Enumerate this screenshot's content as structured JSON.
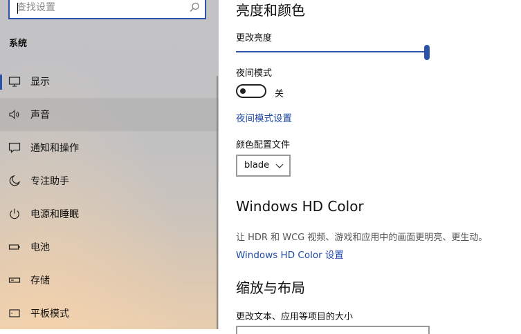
{
  "sidebar": {
    "search": {
      "placeholder": "查找设置",
      "icon": "search-icon"
    },
    "section_title": "系统",
    "items": [
      {
        "label": "显示",
        "icon": "monitor-icon"
      },
      {
        "label": "声音",
        "icon": "speaker-icon"
      },
      {
        "label": "通知和操作",
        "icon": "notification-icon"
      },
      {
        "label": "专注助手",
        "icon": "moon-icon"
      },
      {
        "label": "电源和睡眠",
        "icon": "power-icon"
      },
      {
        "label": "电池",
        "icon": "battery-icon"
      },
      {
        "label": "存储",
        "icon": "storage-icon"
      },
      {
        "label": "平板模式",
        "icon": "tablet-icon"
      }
    ],
    "active_index": 0,
    "hover_index": 1
  },
  "main": {
    "brightness_title": "亮度和颜色",
    "change_brightness_label": "更改亮度",
    "brightness_value": 100,
    "night_light_label": "夜间模式",
    "night_light_state": "关",
    "night_light_settings_link": "夜间模式设置",
    "color_profile_label": "颜色配置文件",
    "color_profile_value": "blade",
    "hd_color_title": "Windows HD Color",
    "hd_color_desc": "让 HDR 和 WCG 视频、游戏和应用中的画面更明亮、更生动。",
    "hd_color_link": "Windows HD Color 设置",
    "scale_title": "缩放与布局",
    "text_size_label": "更改文本、应用等项目的大小"
  },
  "colors": {
    "accent": "#2b53a8",
    "link": "#1f4aa6"
  }
}
